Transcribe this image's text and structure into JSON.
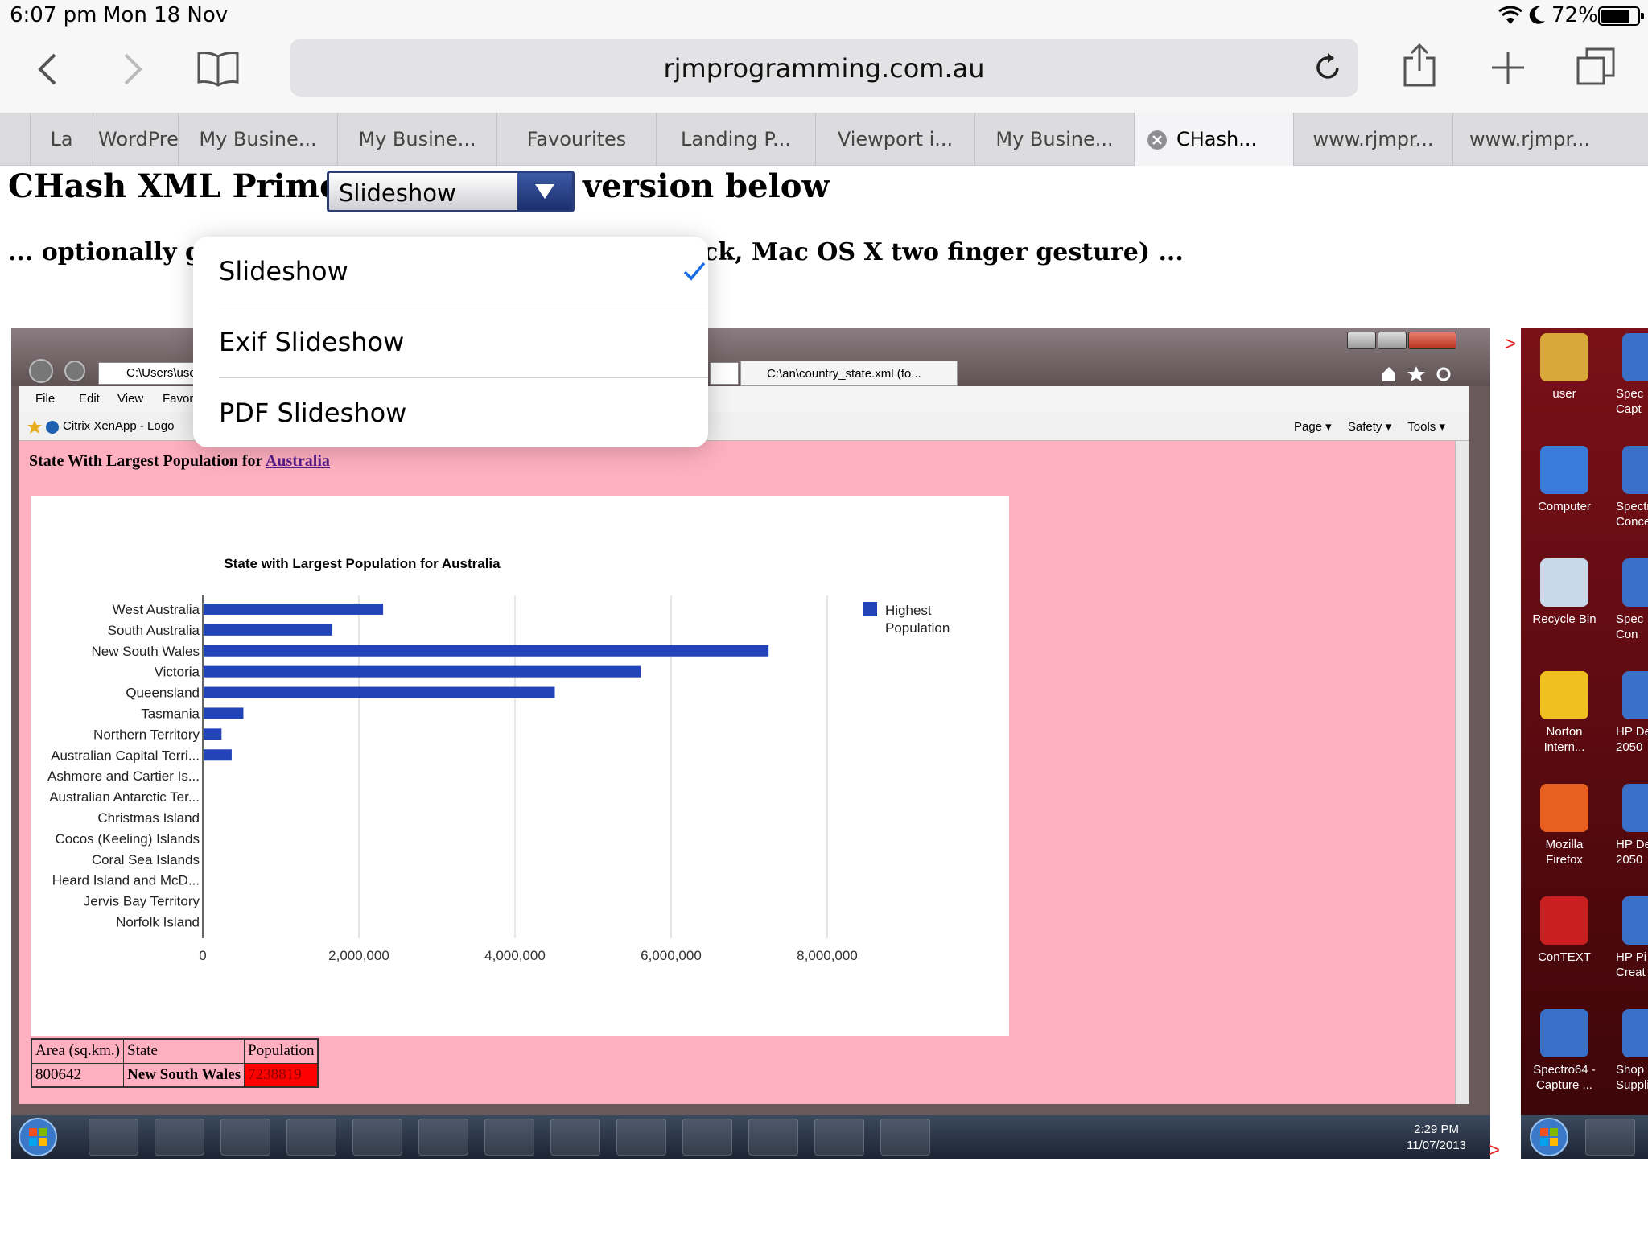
{
  "status_bar": {
    "time": "6:07 pm",
    "date": "Mon 18 Nov",
    "battery": "72%"
  },
  "browser": {
    "url": "rjmprogramming.com.au",
    "icons": [
      "back-icon",
      "forward-icon",
      "bookmarks-icon",
      "reload-icon",
      "share-icon",
      "new-tab-icon",
      "tabs-icon"
    ],
    "tabs": [
      {
        "label": ""
      },
      {
        "label": "La"
      },
      {
        "label": "WordPre"
      },
      {
        "label": "My Busine..."
      },
      {
        "label": "My Busine..."
      },
      {
        "label": "Favourites"
      },
      {
        "label": "Landing P..."
      },
      {
        "label": "Viewport i..."
      },
      {
        "label": "My Busine..."
      },
      {
        "label": "CHash...",
        "active": true
      },
      {
        "label": "www.rjmpr..."
      },
      {
        "label": "www.rjmpr..."
      }
    ]
  },
  "page": {
    "title": "CHash XML Primer",
    "title_suffix": "version below",
    "subtitle_left": "... optionally get",
    "subtitle_right": "ck, Mac OS X two finger gesture) ...",
    "select": {
      "value": "Slideshow",
      "options": [
        {
          "label": "Slideshow",
          "selected": true
        },
        {
          "label": "Exif Slideshow",
          "selected": false
        },
        {
          "label": "PDF Slideshow",
          "selected": false
        }
      ]
    }
  },
  "screenshot": {
    "ie_address": "C:\\Users\\use",
    "ie_tab": "C:\\an\\country_state.xml (fo...",
    "menu": [
      "File",
      "Edit",
      "View",
      "Favorit"
    ],
    "fav_item": "Citrix XenApp - Logo",
    "commands": [
      "Page ▾",
      "Safety ▾",
      "Tools ▾"
    ],
    "heading_prefix": "State With Largest Population for",
    "heading_link": "Australia",
    "table": {
      "headers": [
        "Area (sq.km.)",
        "State",
        "Population"
      ],
      "row": [
        "800642",
        "New South Wales",
        "7238819"
      ]
    },
    "clock_time": "2:29 PM",
    "clock_date": "11/07/2013",
    "desktop_icons": [
      {
        "label": "user",
        "col2": "Spec\nCapt"
      },
      {
        "label": "Computer",
        "col2": "Spectr\nConce"
      },
      {
        "label": "Recycle Bin",
        "col2": "Spec\nCon"
      },
      {
        "label": "Norton\nIntern...",
        "col2": "HP De\n2050"
      },
      {
        "label": "Mozilla\nFirefox",
        "col2": "HP De\n2050"
      },
      {
        "label": "ConTEXT",
        "col2": "HP Pi\nCreat"
      },
      {
        "label": "Spectro64 -\nCapture ...",
        "col2": "Shop\nSuppli"
      }
    ]
  },
  "chart_data": {
    "type": "bar",
    "orientation": "horizontal",
    "title": "State with Largest Population for Australia",
    "categories": [
      "West Australia",
      "South Australia",
      "New South Wales",
      "Victoria",
      "Queensland",
      "Tasmania",
      "Northern Territory",
      "Australian Capital Terri...",
      "Ashmore and Cartier Is...",
      "Australian Antarctic Ter...",
      "Christmas Island",
      "Cocos (Keeling) Islands",
      "Coral Sea Islands",
      "Heard Island and McD...",
      "Jervis Bay Territory",
      "Norfolk Island"
    ],
    "series": [
      {
        "name": "Highest Population",
        "values": [
          2300000,
          1650000,
          7238819,
          5600000,
          4500000,
          510000,
          230000,
          360000,
          0,
          0,
          0,
          0,
          0,
          0,
          0,
          0
        ]
      }
    ],
    "x_ticks": [
      "0",
      "2,000,000",
      "4,000,000",
      "6,000,000",
      "8,000,000"
    ],
    "xlim": [
      0,
      8000000
    ],
    "grid": true,
    "legend": "right",
    "bar_color": "#2343b8"
  }
}
